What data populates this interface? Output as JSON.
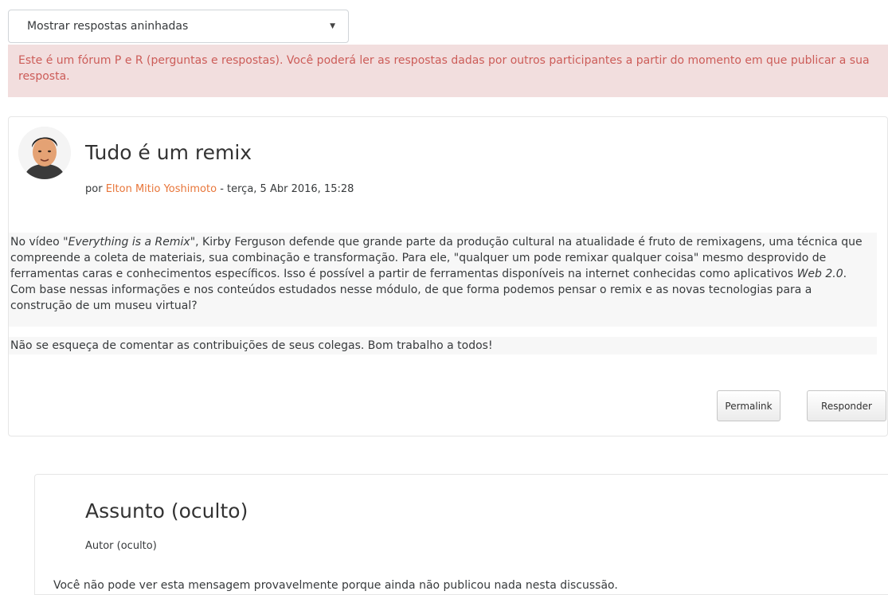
{
  "display_mode": {
    "selected": "Mostrar respostas aninhadas"
  },
  "alert": {
    "text": "Este é um fórum P e R (perguntas e respostas). Você poderá ler as respostas dadas por outros participantes a partir do momento em que publicar a sua resposta.",
    "color": "#cc5c58",
    "background": "#f2dede"
  },
  "post": {
    "title": "Tudo é um remix",
    "byline_prefix": "por",
    "author": "Elton Mitio Yoshimoto",
    "date": "- terça, 5 Abr 2016, 15:28",
    "p1_a": "No vídeo \"",
    "p1_em1": "Everything is a Remix",
    "p1_b": "\", Kirby Ferguson defende que grande parte da produção cultural na atualidade é fruto de remixagens, uma técnica que compreende a coleta de materiais, sua combinação e transformação. Para ele, \"qualquer um pode remixar qualquer coisa\" mesmo desprovido de ferramentas caras e conhecimentos específicos. Isso é possível a partir de ferramentas disponíveis na internet conhecidas como aplicativos ",
    "p1_em2": "Web 2.0",
    "p1_c": ". Com base nessas informações e nos conteúdos estudados nesse módulo, de que forma podemos pensar o remix e as novas tecnologias para a construção de um museu virtual?",
    "p2": "Não se esqueça de comentar as contribuições de seus colegas. Bom trabalho a todos!",
    "permalink_label": "Permalink",
    "reply_label": "Responder",
    "author_color": "#e8763a"
  },
  "hidden_post": {
    "title": "Assunto (oculto)",
    "author": "Autor (oculto)",
    "message": "Você não pode ver esta mensagem provavelmente porque ainda não publicou nada nesta discussão."
  }
}
